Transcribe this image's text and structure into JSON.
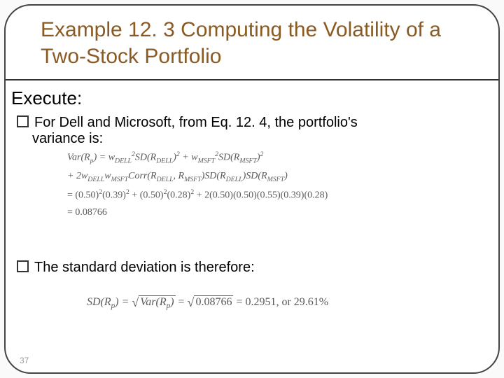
{
  "title": "Example 12. 3 Computing the Volatility of a Two-Stock Portfolio",
  "section": "Execute:",
  "bullets": {
    "p1_a": "For Dell and Microsoft, from Eq. 12. 4, the portfolio's",
    "p1_b": "variance is:",
    "p2": "The standard deviation is therefore:"
  },
  "math": {
    "line1_a": "Var(R",
    "line1_b": ") = w",
    "line1_c": "SD(R",
    "line1_d": ")",
    "line1_e": " + w",
    "line1_f": "SD(R",
    "line1_g": ")",
    "sub_p": "p",
    "sub_dell": "DELL",
    "sub_msft": "MSFT",
    "sup_2": "2",
    "line2_a": "+ 2w",
    "line2_b": "w",
    "line2_c": "Corr(R",
    "line2_d": ", R",
    "line2_e": ")SD(R",
    "line2_f": ")SD(R",
    "line2_g": ")",
    "line3": "= (0.50)",
    "line3b": "(0.39)",
    "line3c": " + (0.50)",
    "line3d": "(0.28)",
    "line3e": " + 2(0.50)(0.50)(0.55)(0.39)(0.28)",
    "line4": "= 0.08766",
    "sd_a": "SD(R",
    "sd_b": ") = ",
    "sd_c": "Var(R",
    "sd_d": ")",
    "sd_eq": " = ",
    "sd_val": "0.08766",
    "sd_res": " = 0.2951, or 29.61%"
  },
  "page_number": "37"
}
